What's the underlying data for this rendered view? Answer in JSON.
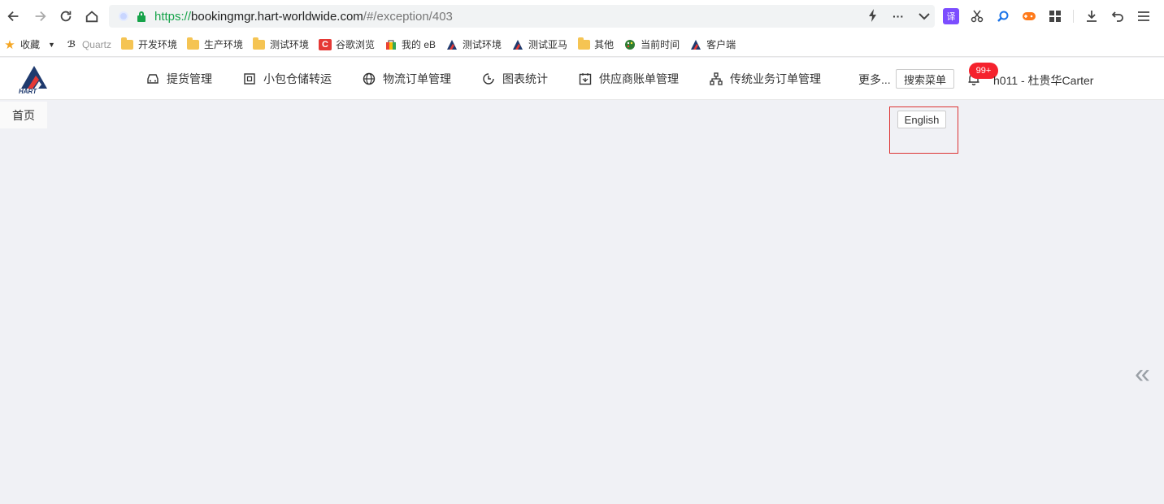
{
  "browser": {
    "url_scheme": "https://",
    "url_host": "bookingmgr.hart-worldwide.com",
    "url_path": "/#/exception/403",
    "more_label": "···"
  },
  "bookmarks": [
    {
      "label": "收藏",
      "icon": "star-icon"
    },
    {
      "label": "Quartz",
      "icon": "quartz-icon"
    },
    {
      "label": "开发环境",
      "icon": "folder-icon"
    },
    {
      "label": "生产环境",
      "icon": "folder-icon"
    },
    {
      "label": "测试环境",
      "icon": "folder-icon"
    },
    {
      "label": "谷歌浏览",
      "icon": "c-icon"
    },
    {
      "label": "我的 eB",
      "icon": "bag-icon"
    },
    {
      "label": "测试环境",
      "icon": "hart-logo-icon"
    },
    {
      "label": "测试亚马",
      "icon": "hart-logo-icon"
    },
    {
      "label": "其他",
      "icon": "folder-icon"
    },
    {
      "label": "当前时间",
      "icon": "palette-icon"
    },
    {
      "label": "客户端",
      "icon": "hart-logo-icon"
    }
  ],
  "header": {
    "logo_text": "HART",
    "menu": [
      {
        "label": "提货管理",
        "icon": "car-icon"
      },
      {
        "label": "小包仓储转运",
        "icon": "package-icon"
      },
      {
        "label": "物流订单管理",
        "icon": "globe-icon"
      },
      {
        "label": "图表统计",
        "icon": "clock-chart-icon"
      },
      {
        "label": "供应商账单管理",
        "icon": "bill-icon"
      },
      {
        "label": "传统业务订单管理",
        "icon": "org-chart-icon"
      }
    ],
    "more_label": "更多...",
    "search_menu_label": "搜索菜单",
    "badge": "99+",
    "user": "h011 - 杜贵华Carter"
  },
  "content": {
    "home_tab": "首页",
    "language_button": "English"
  },
  "colors": {
    "badge": "#f5222d",
    "secure": "#16a34a",
    "background": "#f0f1f5"
  }
}
